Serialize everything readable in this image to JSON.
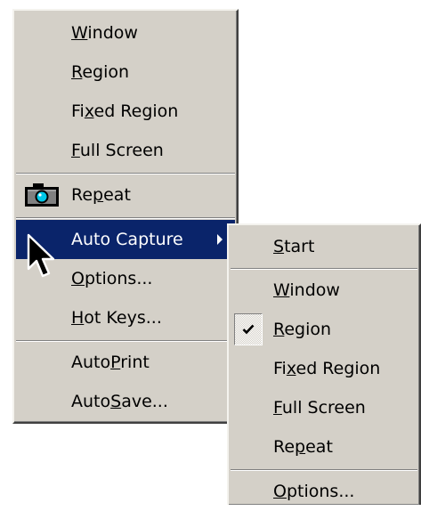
{
  "main_menu": {
    "items": [
      {
        "label": "Window",
        "mnemonic": "W",
        "rest": "indow"
      },
      {
        "label": "Region",
        "mnemonic": "R",
        "rest": "egion"
      },
      {
        "label": "Fixed Region",
        "pre": "Fi",
        "mnemonic": "x",
        "rest": "ed Region"
      },
      {
        "label": "Full Screen",
        "mnemonic": "F",
        "rest": "ull Screen"
      },
      {
        "label": "Repeat",
        "pre": "Re",
        "mnemonic": "p",
        "rest": "eat",
        "icon": "camera-icon"
      },
      {
        "label": "Auto Capture",
        "highlighted": true,
        "submenu": true
      },
      {
        "label": "Options...",
        "mnemonic": "O",
        "rest": "ptions..."
      },
      {
        "label": "Hot Keys...",
        "mnemonic": "H",
        "rest": "ot Keys..."
      },
      {
        "label": "AutoPrint",
        "pre": "Auto",
        "mnemonic": "P",
        "rest": "rint"
      },
      {
        "label": "AutoSave...",
        "pre": "Auto",
        "mnemonic": "S",
        "rest": "ave..."
      }
    ]
  },
  "sub_menu": {
    "items": [
      {
        "label": "Start",
        "mnemonic": "S",
        "rest": "tart"
      },
      {
        "label": "Window",
        "mnemonic": "W",
        "rest": "indow"
      },
      {
        "label": "Region",
        "mnemonic": "R",
        "rest": "egion",
        "checked": true
      },
      {
        "label": "Fixed Region",
        "pre": "Fi",
        "mnemonic": "x",
        "rest": "ed Region"
      },
      {
        "label": "Full Screen",
        "mnemonic": "F",
        "rest": "ull Screen"
      },
      {
        "label": "Repeat",
        "pre": "Re",
        "mnemonic": "p",
        "rest": "eat"
      },
      {
        "label": "Options...",
        "mnemonic": "O",
        "rest": "ptions..."
      }
    ]
  },
  "colors": {
    "menu_bg": "#d4d0c8",
    "highlight": "#0a246a",
    "highlight_text": "#ffffff",
    "camera_lens": "#00c8e8"
  }
}
